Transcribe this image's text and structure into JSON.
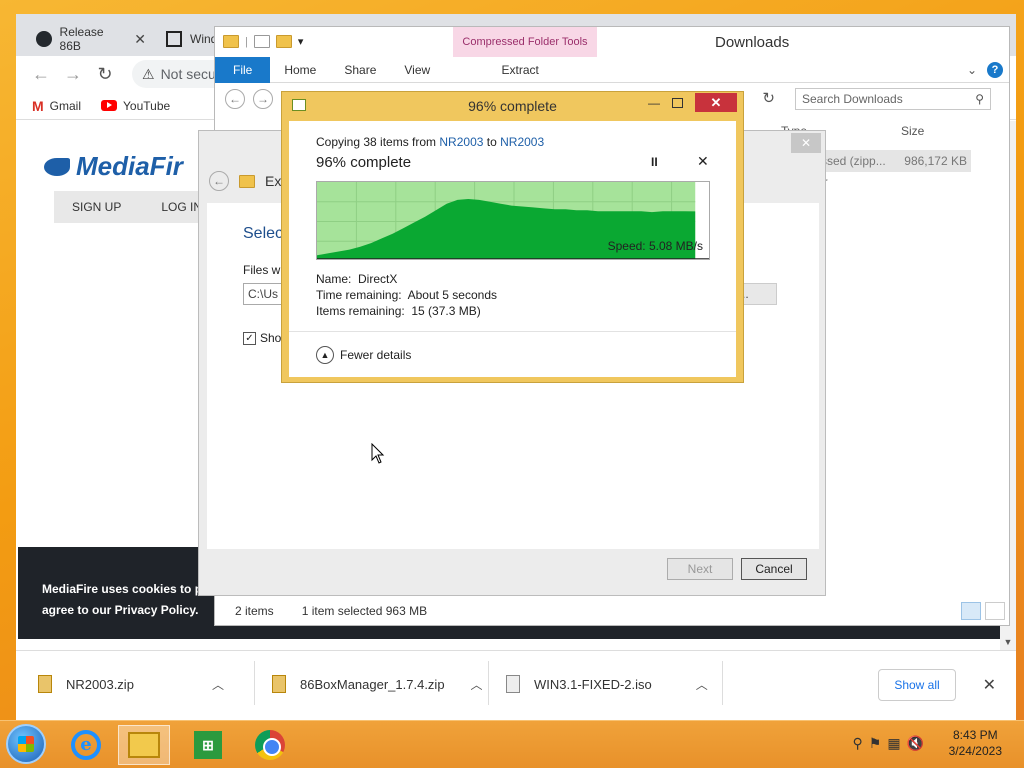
{
  "browser": {
    "tabs": [
      {
        "label": "Release 86B"
      },
      {
        "label": "Wind"
      }
    ],
    "address": {
      "security": "Not secu"
    },
    "bookmarks": [
      {
        "label": "Gmail"
      },
      {
        "label": "YouTube"
      }
    ],
    "page": {
      "logo": "MediaFir",
      "nav": [
        "SIGN UP",
        "LOG IN"
      ],
      "cookie_line1": "MediaFire uses cookies to pr",
      "cookie_line2": "agree to our Privacy Policy."
    },
    "downloads": {
      "items": [
        {
          "name": "NR2003.zip"
        },
        {
          "name": "86BoxManager_1.7.4.zip"
        },
        {
          "name": "WIN3.1-FIXED-2.iso"
        }
      ],
      "show_all": "Show all"
    }
  },
  "explorer": {
    "title": "Downloads",
    "context_tab": "Compressed Folder Tools",
    "ribbon_tabs": [
      "File",
      "Home",
      "Share",
      "View"
    ],
    "context_subtab": "Extract",
    "search_placeholder": "Search Downloads",
    "columns": {
      "type": "Type",
      "size": "Size"
    },
    "row": {
      "type": "ssed (zipp...",
      "size": "986,172 KB"
    },
    "row2_type": "er",
    "status": {
      "count": "2 items",
      "selection": "1 item selected  963 MB"
    }
  },
  "wizard": {
    "title": "Ext",
    "heading": "Selec",
    "files_label": "Files wi",
    "path": "C:\\Us",
    "browse": "e...",
    "show_label": "Sho",
    "show_checked": true,
    "next": "Next",
    "cancel": "Cancel"
  },
  "copy_dialog": {
    "title": "96% complete",
    "copying_prefix": "Copying 38 items from ",
    "source": "NR2003",
    "to": " to ",
    "dest": "NR2003",
    "percent_text": "96% complete",
    "progress_percent": 96,
    "speed": "Speed: 5.08 MB/s",
    "name_label": "Name:",
    "name_value": "DirectX",
    "time_label": "Time remaining:",
    "time_value": "About 5 seconds",
    "items_label": "Items remaining:",
    "items_value": "15 (37.3 MB)",
    "fewer_details": "Fewer details",
    "speed_history": [
      0.4,
      0.6,
      0.8,
      1.0,
      1.3,
      1.7,
      2.2,
      2.7,
      3.3,
      3.9,
      4.5,
      5.2,
      5.9,
      6.3,
      6.4,
      6.3,
      6.1,
      5.9,
      5.7,
      5.6,
      5.5,
      5.4,
      5.3,
      5.3,
      5.2,
      5.2,
      5.1,
      5.1,
      5.1,
      5.1,
      5.1,
      5.0,
      5.1,
      5.1,
      5.1,
      5.08
    ]
  },
  "taskbar": {
    "clock_time": "8:43 PM",
    "clock_date": "3/24/2023"
  },
  "colors": {
    "accent": "#1979ca",
    "graph_fill": "#0aa832",
    "graph_bg": "#a6e39a",
    "dialog_frame": "#f0c75e",
    "close_red": "#c8323c"
  }
}
